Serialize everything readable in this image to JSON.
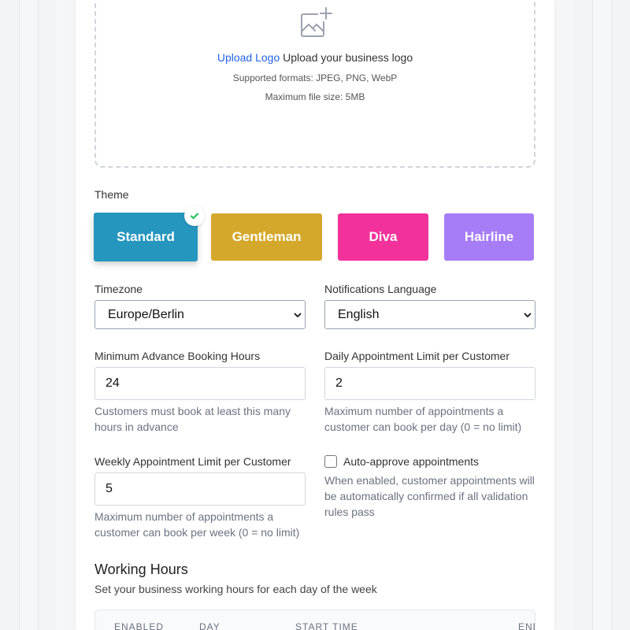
{
  "logo": {
    "icon": "image-add-icon",
    "upload_link": "Upload Logo",
    "upload_text": "Upload your business logo",
    "formats": "Supported formats: JPEG, PNG, WebP",
    "max_size": "Maximum file size: 5MB"
  },
  "theme": {
    "label": "Theme",
    "options": [
      {
        "name": "Standard",
        "color": "#2596be",
        "selected": true
      },
      {
        "name": "Gentleman",
        "color": "#d4a82a",
        "selected": false
      },
      {
        "name": "Diva",
        "color": "#f2319a",
        "selected": false
      },
      {
        "name": "Hairline",
        "color": "#a67cf7",
        "selected": false
      }
    ],
    "selected_icon": "check-icon"
  },
  "timezone": {
    "label": "Timezone",
    "value": "Europe/Berlin"
  },
  "notifications_language": {
    "label": "Notifications Language",
    "value": "English"
  },
  "min_advance": {
    "label": "Minimum Advance Booking Hours",
    "value": "24",
    "help": "Customers must book at least this many hours in advance"
  },
  "daily_limit": {
    "label": "Daily Appointment Limit per Customer",
    "value": "2",
    "help": "Maximum number of appointments a customer can book per day (0 = no limit)"
  },
  "weekly_limit": {
    "label": "Weekly Appointment Limit per Customer",
    "value": "5",
    "help": "Maximum number of appointments a customer can book per week (0 = no limit)"
  },
  "auto_approve": {
    "label": "Auto-approve appointments",
    "checked": false,
    "help": "When enabled, customer appointments will be automatically confirmed if all validation rules pass"
  },
  "working_hours": {
    "title": "Working Hours",
    "subtitle": "Set your business working hours for each day of the week",
    "columns": [
      "Enabled",
      "Day",
      "Start Time",
      "End Time"
    ]
  },
  "colors": {
    "accent_link": "#2563eb",
    "check": "#22c55e"
  }
}
